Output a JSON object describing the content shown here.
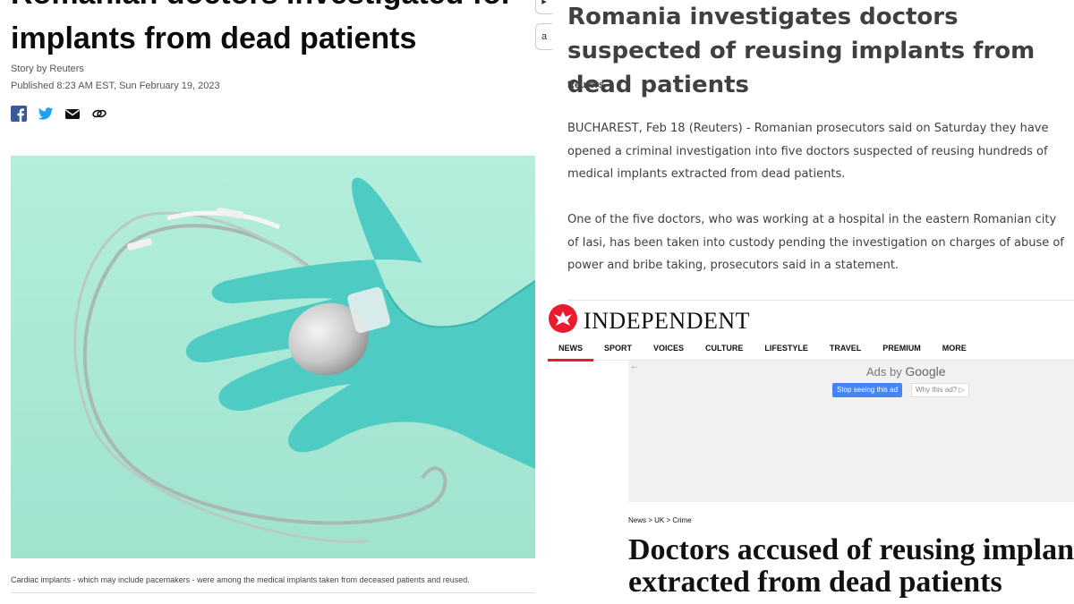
{
  "left_panel": {
    "headline_line1": "Romanian doctors investigated for",
    "headline_line2": "implants from dead patients",
    "byline": "Story by Reuters",
    "published": "Published 8:23 AM EST, Sun February 19, 2023",
    "share_icons": [
      "facebook-icon",
      "twitter-icon",
      "email-icon",
      "link-icon"
    ],
    "caption": "Cardiac implants - which may include pacemakers - were among the medical implants taken from deceased patients and reused.",
    "edge_button_a": "a",
    "colors": {
      "photo_background": "#a8e8d4",
      "glove": "#4ecbc3",
      "facebook": "#3b5998",
      "twitter": "#1da1f2"
    }
  },
  "reuters_panel": {
    "headline": "Romania investigates doctors suspected of reusing implants from dead patients",
    "source": "Reuters",
    "paragraph1": "BUCHAREST, Feb 18 (Reuters) - Romanian prosecutors said on Saturday they have opened a criminal investigation into five doctors suspected of reusing hundreds of medical implants extracted from dead patients.",
    "paragraph2": "One of the five doctors, who was working at a hospital in the eastern Romanian city of Iasi, has been taken into custody pending the investigation on charges of abuse of power and bribe taking, prosecutors said in a statement."
  },
  "independent_panel": {
    "logo_text": "INDEPENDENT",
    "logo_icon": "eagle-icon",
    "nav": [
      "NEWS",
      "SPORT",
      "VOICES",
      "CULTURE",
      "LIFESTYLE",
      "TRAVEL",
      "PREMIUM",
      "MORE"
    ],
    "active_nav": "NEWS",
    "ad": {
      "back_arrow": "←",
      "ads_by": "Ads by",
      "google": "Google",
      "stop_button": "Stop seeing this ad",
      "why_button": "Why this ad? ▷"
    },
    "breadcrumb": "News > UK > Crime",
    "headline_line1": "Doctors accused of reusing implants",
    "headline_line2": "extracted from dead patients",
    "colors": {
      "accent": "#ec1a2e",
      "google_blue": "#4285f4"
    }
  }
}
